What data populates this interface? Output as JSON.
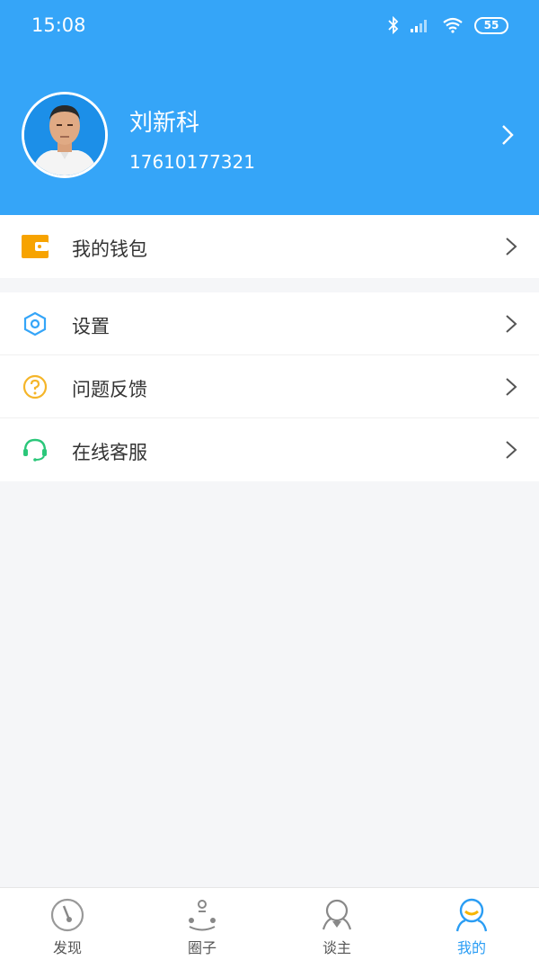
{
  "status_bar": {
    "time": "15:08",
    "battery": "55"
  },
  "profile": {
    "name": "刘新科",
    "phone": "17610177321"
  },
  "menu_group1": [
    {
      "label": "我的钱包",
      "icon": "wallet-icon",
      "color": "#f7a300"
    }
  ],
  "menu_group2": [
    {
      "label": "设置",
      "icon": "settings-hexagon-icon",
      "color": "#35a5f8"
    },
    {
      "label": "问题反馈",
      "icon": "question-icon",
      "color": "#f5b529"
    },
    {
      "label": "在线客服",
      "icon": "headset-icon",
      "color": "#2bc77a"
    }
  ],
  "tabbar": {
    "tabs": [
      {
        "label": "发现",
        "icon": "discover-icon"
      },
      {
        "label": "圈子",
        "icon": "circle-group-icon"
      },
      {
        "label": "谈主",
        "icon": "host-icon"
      },
      {
        "label": "我的",
        "icon": "profile-icon",
        "active": true
      }
    ]
  },
  "colors": {
    "header_bg": "#35a5f8",
    "accent": "#2a9df4",
    "page_bg": "#f5f6f8"
  }
}
